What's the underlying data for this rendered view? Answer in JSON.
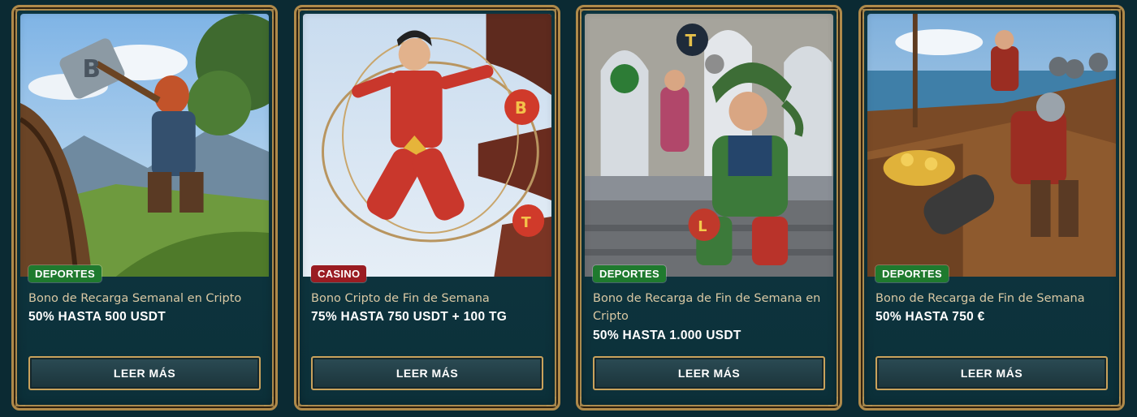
{
  "promotions": [
    {
      "category": "DEPORTES",
      "title": "Bono de Recarga Semanal en Cripto",
      "offer": "50% HASTA 500 USDT",
      "button_label": "LEER MÁS",
      "illustration": "viking-warrior-with-axe"
    },
    {
      "category": "CASINO",
      "title": "Bono Cripto de Fin de Semana",
      "offer": "75% HASTA 750 USDT + 100 TG",
      "button_label": "LEER MÁS",
      "illustration": "martial-artist-with-rope-dart"
    },
    {
      "category": "DEPORTES",
      "title": "Bono de Recarga de Fin de Semana en Cripto",
      "offer": "50% HASTA 1.000 USDT",
      "button_label": "LEER MÁS",
      "illustration": "jester-juggling-coins"
    },
    {
      "category": "DEPORTES",
      "title": "Bono de Recarga de Fin de Semana",
      "offer": "50% HASTA 750 €",
      "button_label": "LEER MÁS",
      "illustration": "pirate-ship-treasure"
    }
  ],
  "colors": {
    "background": "#0b2a33",
    "card_border": "#b08a4a",
    "sports_badge": "#1f7a2e",
    "casino_badge": "#9a1c22",
    "title_text": "#d9c8a3"
  }
}
